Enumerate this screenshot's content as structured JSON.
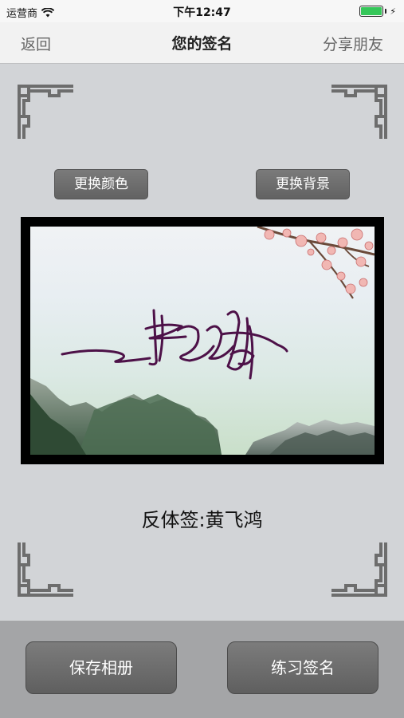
{
  "status_bar": {
    "carrier": "运营商",
    "time": "下午12:47",
    "battery_level": 1.0
  },
  "nav": {
    "back_label": "返回",
    "title": "您的签名",
    "share_label": "分享朋友"
  },
  "controls": {
    "change_color_label": "更换颜色",
    "change_background_label": "更换背景"
  },
  "signature": {
    "caption": "反体签:黄飞鸿",
    "ink_color": "#4d1148"
  },
  "actions": {
    "save_label": "保存相册",
    "practice_label": "练习签名"
  },
  "colors": {
    "background": "#d2d4d7",
    "button": "#6e6e6e",
    "bottom_bar": "#a4a5a7"
  }
}
